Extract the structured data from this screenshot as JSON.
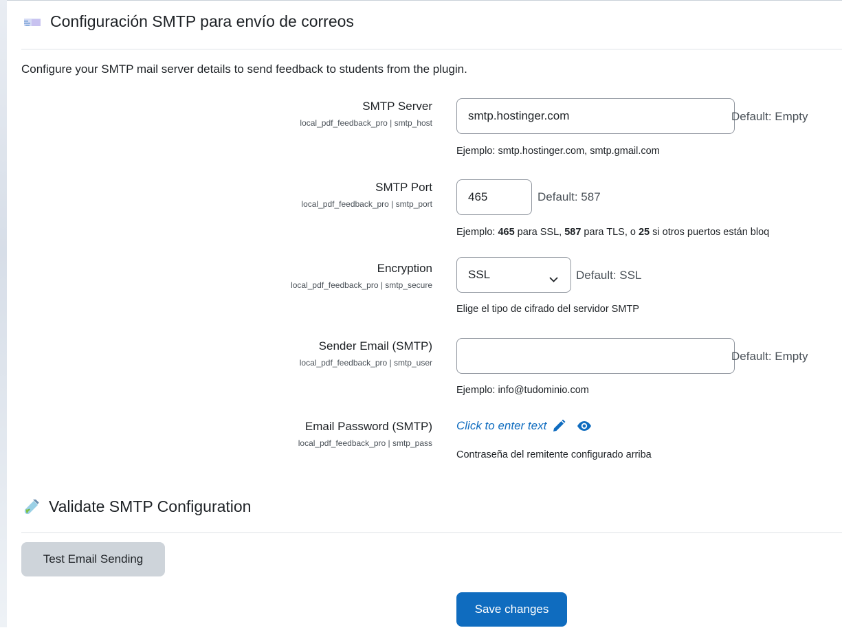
{
  "section_smtp": {
    "title": "Configuración SMTP para envío de correos",
    "icon": "envelope-icon",
    "intro": "Configure your SMTP mail server details to send feedback to students from the plugin."
  },
  "settings": {
    "server": {
      "label": "SMTP Server",
      "key": "local_pdf_feedback_pro | smtp_host",
      "value": "smtp.hostinger.com",
      "default": "Default: Empty",
      "help": "Ejemplo: smtp.hostinger.com, smtp.gmail.com"
    },
    "port": {
      "label": "SMTP Port",
      "key": "local_pdf_feedback_pro | smtp_port",
      "value": "465",
      "default": "Default: 587",
      "help_prefix": "Ejemplo: ",
      "help_b1": "465",
      "help_mid1": " para SSL, ",
      "help_b2": "587",
      "help_mid2": " para TLS, o ",
      "help_b3": "25",
      "help_suffix": " si otros puertos están bloq"
    },
    "encryption": {
      "label": "Encryption",
      "key": "local_pdf_feedback_pro | smtp_secure",
      "value": "SSL",
      "default": "Default: SSL",
      "help": "Elige el tipo de cifrado del servidor SMTP"
    },
    "sender": {
      "label": "Sender Email (SMTP)",
      "key": "local_pdf_feedback_pro | smtp_user",
      "value": "",
      "default": "Default: Empty",
      "help": "Ejemplo: info@tudominio.com"
    },
    "password": {
      "label": "Email Password (SMTP)",
      "key": "local_pdf_feedback_pro | smtp_pass",
      "link": "Click to enter text",
      "help": "Contraseña del remitente configurado arriba"
    }
  },
  "section_validate": {
    "title": "Validate SMTP Configuration",
    "icon": "test-tube-icon",
    "button": "Test Email Sending"
  },
  "save_button": "Save changes",
  "colors": {
    "primary": "#0f6cbf",
    "secondary_btn": "#ced4da",
    "border": "#8f959e"
  }
}
